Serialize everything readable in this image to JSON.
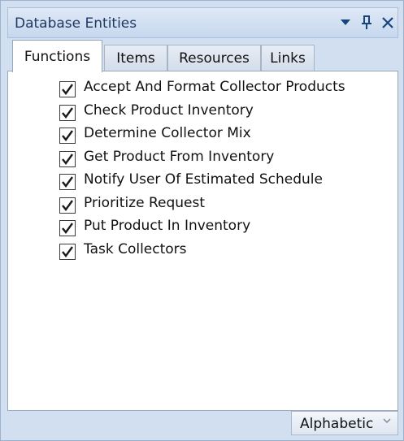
{
  "panel": {
    "title": "Database Entities",
    "controls": {
      "dropdown_icon": "triangle-down-icon",
      "pin_icon": "pin-icon",
      "close_icon": "close-icon"
    }
  },
  "tabs": [
    {
      "label": "Functions",
      "active": true
    },
    {
      "label": "Items",
      "active": false
    },
    {
      "label": "Resources",
      "active": false
    },
    {
      "label": "Links",
      "active": false
    }
  ],
  "functions": [
    {
      "label": "Accept And Format Collector Products",
      "checked": true
    },
    {
      "label": "Check Product Inventory",
      "checked": true
    },
    {
      "label": "Determine Collector Mix",
      "checked": true
    },
    {
      "label": "Get Product From Inventory",
      "checked": true
    },
    {
      "label": "Notify User Of Estimated Schedule",
      "checked": true
    },
    {
      "label": "Prioritize Request",
      "checked": true
    },
    {
      "label": "Put Product In Inventory",
      "checked": true
    },
    {
      "label": "Task Collectors",
      "checked": true
    }
  ],
  "sort": {
    "value": "Alphabetic"
  },
  "colors": {
    "title_text": "#1e3a63",
    "panel_bg": "#d2dff0",
    "control_blue": "#15447f"
  }
}
